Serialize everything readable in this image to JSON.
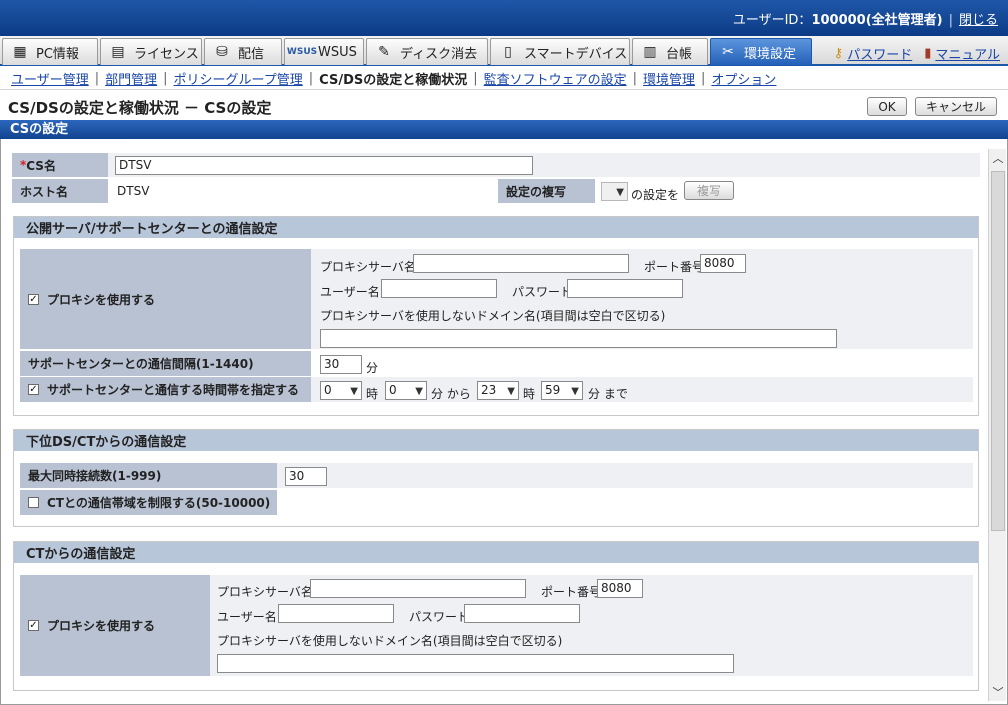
{
  "header": {
    "user_id_label": "ユーザーID：",
    "user_id_value": "100000(全社管理者)",
    "separator": "|",
    "logout": "閉じる"
  },
  "tabs": [
    {
      "label": "PC情報",
      "icon": "pc-info-icon",
      "glyph": "▦"
    },
    {
      "label": "ライセンス",
      "icon": "license-icon",
      "glyph": "▤"
    },
    {
      "label": "配信",
      "icon": "distribution-icon",
      "glyph": "⛁"
    },
    {
      "label": "WSUS",
      "icon": "wsus-icon",
      "glyph": "WSUS"
    },
    {
      "label": "ディスク消去",
      "icon": "disk-erase-icon",
      "glyph": "✎"
    },
    {
      "label": "スマートデバイス",
      "icon": "smart-device-icon",
      "glyph": "▯"
    },
    {
      "label": "台帳",
      "icon": "ledger-icon",
      "glyph": "▥"
    },
    {
      "label": "環境設定",
      "icon": "settings-tools-icon",
      "glyph": "✂"
    }
  ],
  "tab_links": {
    "password": "パスワード",
    "manual": "マニュアル",
    "password_icon": "key-icon",
    "manual_icon": "book-icon"
  },
  "subnav": {
    "items": [
      "ユーザー管理",
      "部門管理",
      "ポリシーグループ管理",
      "CS/DSの設定と稼働状況",
      "監査ソフトウェアの設定",
      "環境管理",
      "オプション"
    ],
    "bar": "|"
  },
  "page": {
    "title": "CS/DSの設定と稼働状況 － CSの設定",
    "ok": "OK",
    "cancel": "キャンセル",
    "section_title": "CSの設定"
  },
  "cs": {
    "name_label_req": "*",
    "name_label": "CS名",
    "name_value": "DTSV",
    "host_label": "ホスト名",
    "host_value": "DTSV",
    "copy_label": "設定の複写",
    "copy_suffix": "の設定を",
    "copy_button": "複写"
  },
  "public_server": {
    "title": "公開サーバ/サポートセンターとの通信設定",
    "use_proxy": "プロキシを使用する",
    "use_proxy_checked": true,
    "proxy_server_label": "プロキシサーバ名",
    "proxy_server_value": "",
    "port_label": "ポート番号",
    "port_value": "8080",
    "user_label": "ユーザー名",
    "user_value": "",
    "password_label": "パスワード",
    "password_value": "",
    "no_proxy_label": "プロキシサーバを使用しないドメイン名(項目間は空白で区切る)",
    "no_proxy_value": "",
    "interval_label": "サポートセンターとの通信間隔(1-1440)",
    "interval_value": "30",
    "interval_unit": "分",
    "time_range_label": "サポートセンターと通信する時間帯を指定する",
    "time_range_checked": true,
    "from_hour": "0",
    "hour_unit": "時",
    "from_min": "0",
    "from_suffix": "分 から",
    "to_hour": "23",
    "to_min": "59",
    "to_suffix": "分 まで"
  },
  "lower_ds": {
    "title": "下位DS/CTからの通信設定",
    "max_conn_label": "最大同時接続数(1-999)",
    "max_conn_value": "30",
    "limit_bw_label": "CTとの通信帯域を制限する(50-10000)",
    "limit_bw_checked": false
  },
  "ct": {
    "title": "CTからの通信設定",
    "use_proxy": "プロキシを使用する",
    "use_proxy_checked": true,
    "proxy_server_label": "プロキシサーバ名",
    "proxy_server_value": "",
    "port_label": "ポート番号",
    "port_value": "8080",
    "user_label": "ユーザー名",
    "user_value": "",
    "password_label": "パスワード",
    "password_value": "",
    "no_proxy_label": "プロキシサーバを使用しないドメイン名(項目間は空白で区切る)",
    "no_proxy_value": ""
  },
  "colors": {
    "header_blue": "#0c3b86",
    "label_bg": "#b8c2d2",
    "link": "#1a46a8"
  }
}
